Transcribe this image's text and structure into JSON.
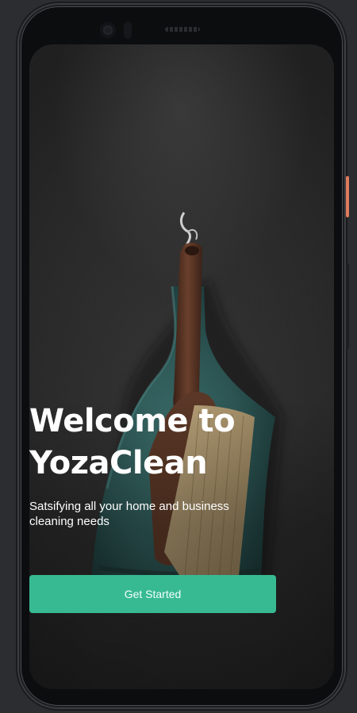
{
  "welcome": {
    "title_line1": "Welcome to",
    "title_line2": "YozaClean",
    "subtitle": "Satsifying all your home and business cleaning needs",
    "cta_label": "Get Started"
  },
  "colors": {
    "accent": "#37ba92",
    "background": "#2b2d30",
    "side_button": "#e07a5c"
  },
  "icons": {
    "hero": "dustpan-and-brush-photo",
    "camera": "front-camera"
  }
}
